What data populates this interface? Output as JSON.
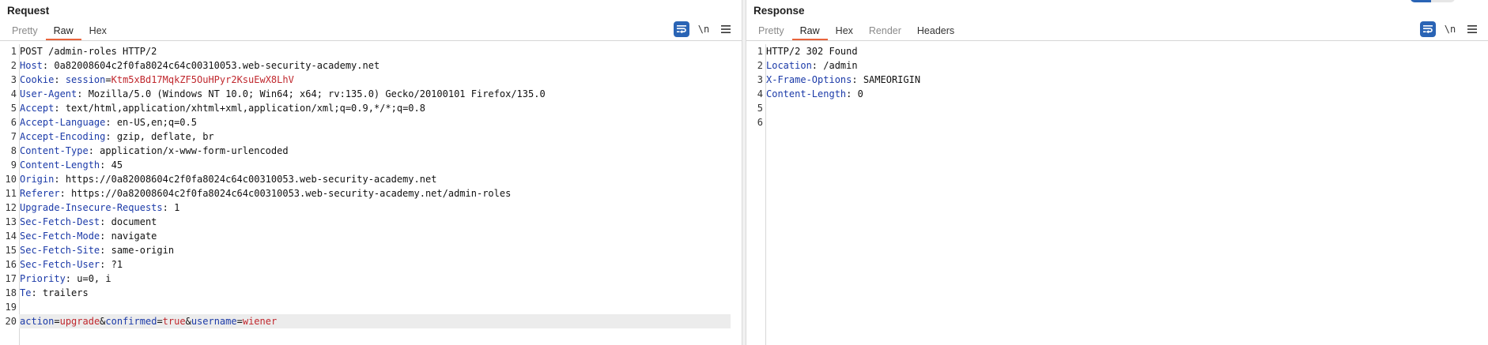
{
  "request": {
    "title": "Request",
    "tabs": [
      {
        "label": "Pretty",
        "state": "disabled"
      },
      {
        "label": "Raw",
        "state": "active"
      },
      {
        "label": "Hex",
        "state": "normal"
      }
    ],
    "tools": {
      "wrap_icon": "wrap-lines-icon",
      "newline_label": "\\n",
      "menu_icon": "hamburger-menu-icon"
    },
    "lines": [
      {
        "n": "1",
        "text": "POST /admin-roles HTTP/2"
      },
      {
        "n": "2",
        "name": "Host",
        "value": "0a82008604c2f0fa8024c64c00310053.web-security-academy.net"
      },
      {
        "n": "3",
        "name": "Cookie",
        "cookie_name": "session",
        "cookie_value": "Ktm5xBd17MqkZF5OuHPyr2KsuEwX8LhV"
      },
      {
        "n": "4",
        "name": "User-Agent",
        "value": "Mozilla/5.0 (Windows NT 10.0; Win64; x64; rv:135.0) Gecko/20100101 Firefox/135.0"
      },
      {
        "n": "5",
        "name": "Accept",
        "value": "text/html,application/xhtml+xml,application/xml;q=0.9,*/*;q=0.8"
      },
      {
        "n": "6",
        "name": "Accept-Language",
        "value": "en-US,en;q=0.5"
      },
      {
        "n": "7",
        "name": "Accept-Encoding",
        "value": "gzip, deflate, br"
      },
      {
        "n": "8",
        "name": "Content-Type",
        "value": "application/x-www-form-urlencoded"
      },
      {
        "n": "9",
        "name": "Content-Length",
        "value": "45"
      },
      {
        "n": "10",
        "name": "Origin",
        "value": "https://0a82008604c2f0fa8024c64c00310053.web-security-academy.net"
      },
      {
        "n": "11",
        "name": "Referer",
        "value": "https://0a82008604c2f0fa8024c64c00310053.web-security-academy.net/admin-roles"
      },
      {
        "n": "12",
        "name": "Upgrade-Insecure-Requests",
        "value": "1"
      },
      {
        "n": "13",
        "name": "Sec-Fetch-Dest",
        "value": "document"
      },
      {
        "n": "14",
        "name": "Sec-Fetch-Mode",
        "value": "navigate"
      },
      {
        "n": "15",
        "name": "Sec-Fetch-Site",
        "value": "same-origin"
      },
      {
        "n": "16",
        "name": "Sec-Fetch-User",
        "value": "?1"
      },
      {
        "n": "17",
        "name": "Priority",
        "value": "u=0, i"
      },
      {
        "n": "18",
        "name": "Te",
        "value": "trailers"
      },
      {
        "n": "19",
        "text": ""
      },
      {
        "n": "20",
        "params": [
          {
            "name": "action",
            "value": "upgrade"
          },
          {
            "name": "confirmed",
            "value": "true"
          },
          {
            "name": "username",
            "value": "wiener"
          }
        ]
      }
    ]
  },
  "response": {
    "title": "Response",
    "tabs": [
      {
        "label": "Pretty",
        "state": "disabled"
      },
      {
        "label": "Raw",
        "state": "active"
      },
      {
        "label": "Hex",
        "state": "normal"
      },
      {
        "label": "Render",
        "state": "disabled"
      },
      {
        "label": "Headers",
        "state": "normal"
      }
    ],
    "tools": {
      "wrap_icon": "wrap-lines-icon",
      "newline_label": "\\n",
      "menu_icon": "hamburger-menu-icon"
    },
    "lines": [
      {
        "n": "1",
        "text": "HTTP/2 302 Found"
      },
      {
        "n": "2",
        "name": "Location",
        "value": "/admin"
      },
      {
        "n": "3",
        "name": "X-Frame-Options",
        "value": "SAMEORIGIN"
      },
      {
        "n": "4",
        "name": "Content-Length",
        "value": "0"
      },
      {
        "n": "5",
        "text": ""
      },
      {
        "n": "6",
        "text": ""
      }
    ]
  },
  "colors": {
    "accent": "#e8643c",
    "header_name": "#1b3aa8",
    "value_red": "#c0272d",
    "toggle_blue": "#2a64b5"
  }
}
